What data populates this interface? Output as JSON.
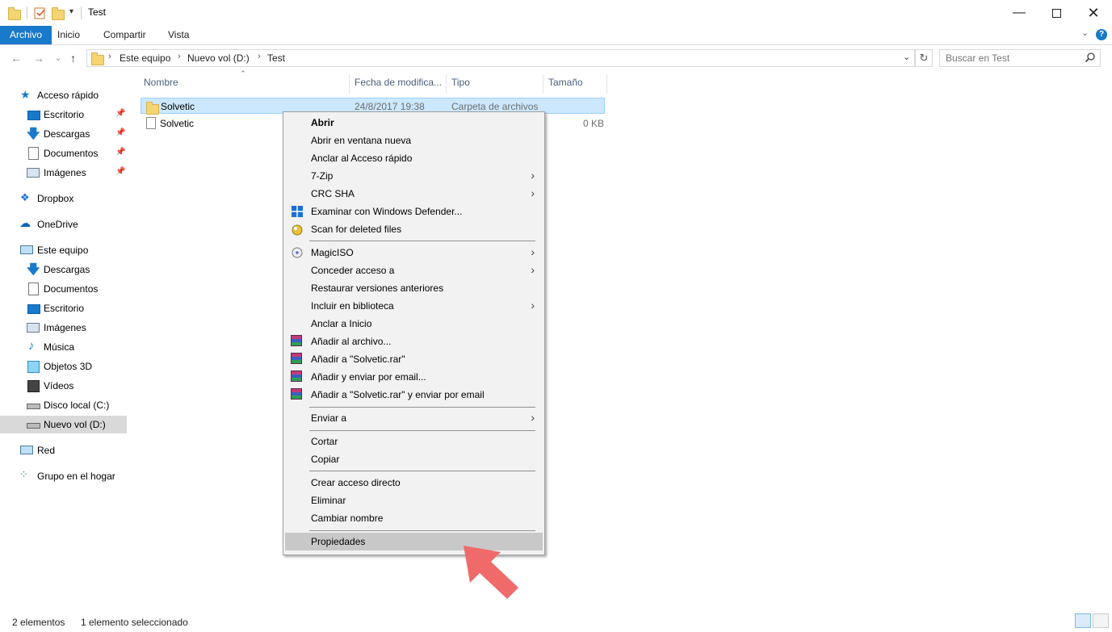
{
  "window": {
    "title": "Test"
  },
  "ribbon": {
    "tabs": [
      "Archivo",
      "Inicio",
      "Compartir",
      "Vista"
    ]
  },
  "address": {
    "crumbs": [
      "Este equipo",
      "Nuevo vol (D:)",
      "Test"
    ],
    "search_placeholder": "Buscar en Test"
  },
  "sidebar": {
    "quick_access": "Acceso rápido",
    "quick_items": [
      "Escritorio",
      "Descargas",
      "Documentos",
      "Imágenes"
    ],
    "dropbox": "Dropbox",
    "onedrive": "OneDrive",
    "this_pc": "Este equipo",
    "pc_items": [
      "Descargas",
      "Documentos",
      "Escritorio",
      "Imágenes",
      "Música",
      "Objetos 3D",
      "Vídeos",
      "Disco local (C:)",
      "Nuevo vol (D:)"
    ],
    "network": "Red",
    "homegroup": "Grupo en el hogar"
  },
  "columns": {
    "name": "Nombre",
    "date": "Fecha de modifica...",
    "type": "Tipo",
    "size": "Tamaño"
  },
  "files": [
    {
      "name": "Solvetic",
      "date": "24/8/2017 19:38",
      "type": "Carpeta de archivos",
      "size": ""
    },
    {
      "name": "Solvetic",
      "date": "",
      "type": "",
      "size": "0 KB"
    }
  ],
  "menu": {
    "open": "Abrir",
    "open_new": "Abrir en ventana nueva",
    "pin_quick": "Anclar al Acceso rápido",
    "zip": "7-Zip",
    "crc": "CRC SHA",
    "defender": "Examinar con Windows Defender...",
    "scan": "Scan for deleted files",
    "magiciso": "MagicISO",
    "grant": "Conceder acceso a",
    "restore": "Restaurar versiones anteriores",
    "library": "Incluir en biblioteca",
    "pin_start": "Anclar a Inicio",
    "add_archive": "Añadir al archivo...",
    "add_rar": "Añadir a \"Solvetic.rar\"",
    "add_email": "Añadir y enviar por email...",
    "add_rar_email": "Añadir a \"Solvetic.rar\" y enviar por email",
    "send_to": "Enviar a",
    "cut": "Cortar",
    "copy": "Copiar",
    "shortcut": "Crear acceso directo",
    "delete": "Eliminar",
    "rename": "Cambiar nombre",
    "properties": "Propiedades"
  },
  "status": {
    "count": "2 elementos",
    "selected": "1 elemento seleccionado"
  },
  "colors": {
    "accent": "#1979ca",
    "selection": "#cce8ff",
    "arrow": "#f06a6a"
  }
}
